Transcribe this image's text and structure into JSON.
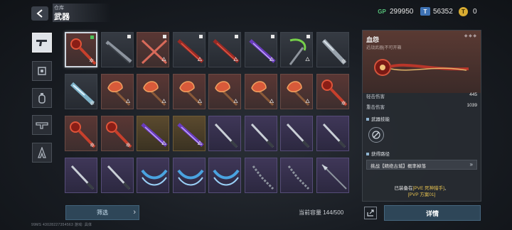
{
  "header": {
    "breadcrumb": "仓库",
    "title": "武器",
    "currencies": [
      {
        "icon": "gp-icon",
        "label": "GP",
        "value": "299950",
        "color": "#56c27a"
      },
      {
        "icon": "ticket-icon",
        "label": "T",
        "value": "56352",
        "color": "#4f8fd8"
      },
      {
        "icon": "gold-coin-icon",
        "label": "",
        "value": "0",
        "color": "#e0b640"
      }
    ]
  },
  "nav": [
    {
      "name": "nav-pistol",
      "icon": "pistol-icon",
      "active": true
    },
    {
      "name": "nav-chip",
      "icon": "chip-icon",
      "active": false
    },
    {
      "name": "nav-grenade",
      "icon": "grenade-icon",
      "active": false
    },
    {
      "name": "nav-rifle",
      "icon": "rifle-icon",
      "active": false
    },
    {
      "name": "nav-character",
      "icon": "character-icon",
      "active": false
    }
  ],
  "grid": [
    {
      "rarity": "red",
      "weapon": "mace",
      "mark": "green",
      "selected": true,
      "badge": "✲"
    },
    {
      "rarity": "plain",
      "weapon": "blade",
      "mark": "white",
      "badge": ""
    },
    {
      "rarity": "red",
      "weapon": "cross-swords",
      "mark": "white",
      "badge": "🜂"
    },
    {
      "rarity": "plain",
      "weapon": "red-blade",
      "mark": "white",
      "badge": "🜂"
    },
    {
      "rarity": "plain",
      "weapon": "red-blade",
      "mark": "white",
      "badge": "🜂"
    },
    {
      "rarity": "plain",
      "weapon": "purple-blade",
      "mark": "white",
      "badge": "🜂"
    },
    {
      "rarity": "plain",
      "weapon": "scythe",
      "mark": "white",
      "badge": "🜂"
    },
    {
      "rarity": "plain",
      "weapon": "knife",
      "mark": "",
      "badge": "✲"
    },
    {
      "rarity": "plain",
      "weapon": "knife-ice",
      "mark": "",
      "badge": "✲"
    },
    {
      "rarity": "red",
      "weapon": "axe",
      "mark": "",
      "badge": "🜂"
    },
    {
      "rarity": "red",
      "weapon": "axe",
      "mark": "",
      "badge": "🜂"
    },
    {
      "rarity": "red",
      "weapon": "axe",
      "mark": "",
      "badge": "🜂"
    },
    {
      "rarity": "red",
      "weapon": "axe",
      "mark": "",
      "badge": "🜂"
    },
    {
      "rarity": "red",
      "weapon": "axe",
      "mark": "",
      "badge": "🜂"
    },
    {
      "rarity": "red",
      "weapon": "axe",
      "mark": "",
      "badge": "🜂"
    },
    {
      "rarity": "red",
      "weapon": "mace",
      "mark": "",
      "badge": "✲"
    },
    {
      "rarity": "red",
      "weapon": "mace",
      "mark": "",
      "badge": "✲"
    },
    {
      "rarity": "red",
      "weapon": "mace",
      "mark": "",
      "badge": "✲"
    },
    {
      "rarity": "gold",
      "weapon": "purple-blade",
      "mark": "",
      "badge": "🜂"
    },
    {
      "rarity": "gold",
      "weapon": "purple-blade",
      "mark": "",
      "badge": "🜂"
    },
    {
      "rarity": "purple",
      "weapon": "dagger",
      "mark": "",
      "badge": ""
    },
    {
      "rarity": "purple",
      "weapon": "dagger",
      "mark": "",
      "badge": ""
    },
    {
      "rarity": "purple",
      "weapon": "dagger",
      "mark": "",
      "badge": ""
    },
    {
      "rarity": "purple",
      "weapon": "dagger",
      "mark": "",
      "badge": ""
    },
    {
      "rarity": "purple",
      "weapon": "dagger",
      "mark": "",
      "badge": ""
    },
    {
      "rarity": "purple",
      "weapon": "dagger",
      "mark": "",
      "badge": ""
    },
    {
      "rarity": "purple",
      "weapon": "twin-blades",
      "mark": "",
      "badge": ""
    },
    {
      "rarity": "purple",
      "weapon": "twin-blades",
      "mark": "",
      "badge": ""
    },
    {
      "rarity": "purple",
      "weapon": "twin-blades",
      "mark": "",
      "badge": ""
    },
    {
      "rarity": "purple",
      "weapon": "nunchaku",
      "mark": "",
      "badge": ""
    },
    {
      "rarity": "purple",
      "weapon": "nunchaku",
      "mark": "",
      "badge": ""
    },
    {
      "rarity": "purple",
      "weapon": "spear",
      "mark": "",
      "badge": ""
    }
  ],
  "bottom": {
    "filter_label": "筛选",
    "capacity": "当前容量 144/500",
    "detail_label": "详情",
    "footer": "99MS  43028227354563      游戏: 具体"
  },
  "panel": {
    "name": "血怨",
    "subtitle": "近战武器|不可开箱",
    "stats": [
      {
        "label": "轻击伤害",
        "value": "445"
      },
      {
        "label": "重击伤害",
        "value": "1039"
      }
    ],
    "skill_section": "武器技能",
    "source_section": "获得路径",
    "source_text": "挑战【精绝古城】概率掉落",
    "equipped_line1": "已装备在",
    "equipped_hl1": "[PVE 死神猎手]",
    "equipped_sep": "、",
    "equipped_hl2": "[PVP 方案01]"
  }
}
